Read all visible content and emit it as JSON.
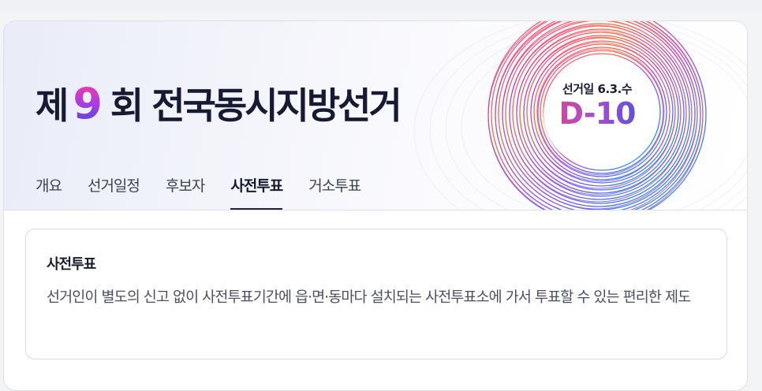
{
  "hero": {
    "title_prefix": "제",
    "title_number": "9",
    "title_suffix": "회 전국동시지방선거",
    "badge_date": "선거일 6.3.수",
    "badge_countdown": "D-10"
  },
  "tabs": [
    {
      "label": "개요",
      "active": false
    },
    {
      "label": "선거일정",
      "active": false
    },
    {
      "label": "후보자",
      "active": false
    },
    {
      "label": "사전투표",
      "active": true
    },
    {
      "label": "거소투표",
      "active": false
    }
  ],
  "info": {
    "title": "사전투표",
    "description": "선거인이 별도의 신고 없이 사전투표기간에 읍·면·동마다 설치되는 사전투표소에 가서 투표할 수 있는 편리한 제도"
  },
  "colors": {
    "accent_pink": "#e0458f",
    "accent_purple": "#a74bd2",
    "accent_blue": "#4a52de",
    "active_tab_underline": "#1f2540"
  }
}
